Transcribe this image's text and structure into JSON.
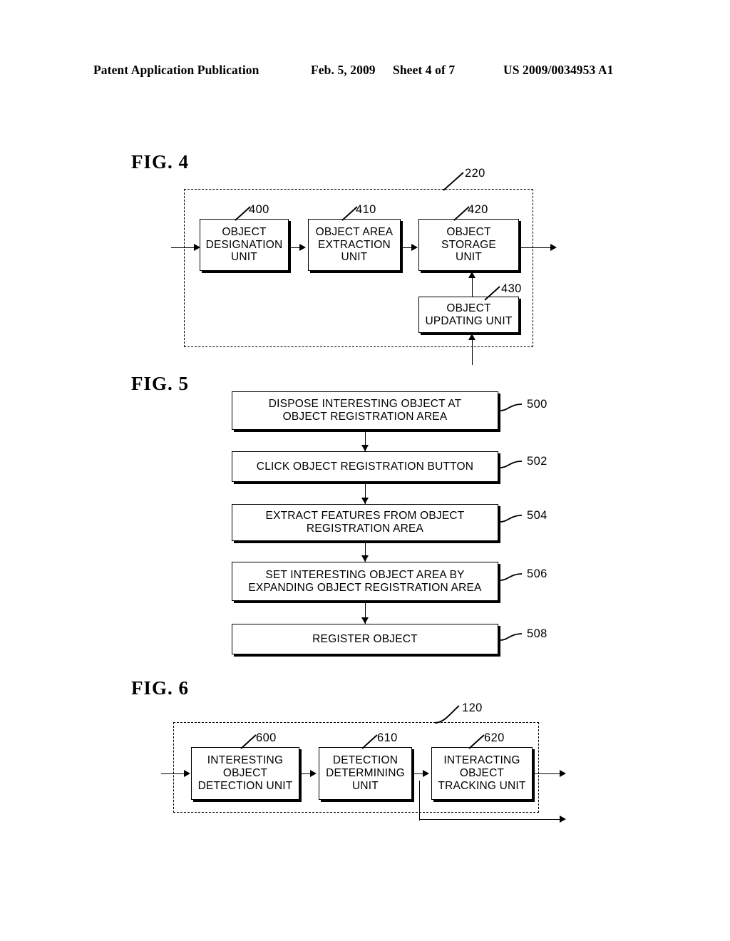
{
  "header": {
    "publication": "Patent Application Publication",
    "date": "Feb. 5, 2009",
    "sheet": "Sheet 4 of 7",
    "patent_number": "US 2009/0034953 A1"
  },
  "figures": [
    {
      "title": "FIG.  4",
      "container_ref": "220",
      "blocks": [
        {
          "ref": "400",
          "label": "OBJECT\nDESIGNATION\nUNIT"
        },
        {
          "ref": "410",
          "label": "OBJECT AREA\nEXTRACTION\nUNIT"
        },
        {
          "ref": "420",
          "label": "OBJECT\nSTORAGE\nUNIT"
        },
        {
          "ref": "430",
          "label": "OBJECT\nUPDATING UNIT"
        }
      ]
    },
    {
      "title": "FIG.  5",
      "steps": [
        {
          "ref": "500",
          "label": "DISPOSE INTERESTING OBJECT AT\nOBJECT REGISTRATION AREA"
        },
        {
          "ref": "502",
          "label": "CLICK OBJECT REGISTRATION BUTTON"
        },
        {
          "ref": "504",
          "label": "EXTRACT FEATURES FROM OBJECT\nREGISTRATION AREA"
        },
        {
          "ref": "506",
          "label": "SET INTERESTING OBJECT AREA BY\nEXPANDING OBJECT REGISTRATION AREA"
        },
        {
          "ref": "508",
          "label": "REGISTER OBJECT"
        }
      ]
    },
    {
      "title": "FIG.  6",
      "container_ref": "120",
      "blocks": [
        {
          "ref": "600",
          "label": "INTERESTING\nOBJECT\nDETECTION UNIT"
        },
        {
          "ref": "610",
          "label": "DETECTION\nDETERMINING\nUNIT"
        },
        {
          "ref": "620",
          "label": "INTERACTING\nOBJECT\nTRACKING UNIT"
        }
      ]
    }
  ],
  "colors": {
    "ink": "#000000",
    "paper": "#ffffff"
  }
}
